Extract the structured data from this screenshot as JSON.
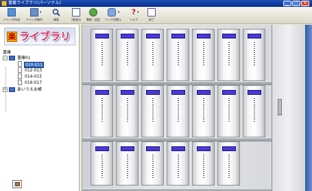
{
  "window": {
    "title": "書籍ライブラリ(パーソナル)",
    "minimize": "_",
    "maximize": "□",
    "close": "✕"
  },
  "toolbar": {
    "buttons": [
      {
        "label": "バインダ作成",
        "icon": "binder-create-icon"
      },
      {
        "label": "バインダ操作",
        "icon": "binder-operate-icon"
      },
      {
        "label": "検索",
        "icon": "search-icon"
      },
      {
        "label": "1枚表示",
        "icon": "single-page-icon"
      },
      {
        "label": "整理・設定",
        "icon": "organize-settings-icon"
      },
      {
        "label": "リンク切替え",
        "icon": "link-switch-icon"
      },
      {
        "label": "ヘルプ",
        "icon": "help-icon"
      },
      {
        "label": "終了",
        "icon": "exit-icon"
      }
    ]
  },
  "sidebar": {
    "logo_mark": "楽",
    "logo_text": "ライブラリ",
    "tree_header": "書庫",
    "tree": [
      {
        "label": "書庫01",
        "expander": "−",
        "level": 0
      },
      {
        "label": "010-011",
        "level": 1,
        "selected": true
      },
      {
        "label": "012-013",
        "level": 1
      },
      {
        "label": "014-015",
        "level": 1
      },
      {
        "label": "016-017",
        "level": 1
      },
      {
        "label": "あいうえお帳",
        "expander": "+",
        "level": 0
      }
    ]
  },
  "bookcase": {
    "rows": [
      {
        "books": 7
      },
      {
        "books": 7
      },
      {
        "books": 6
      }
    ],
    "colors": {
      "label": "#4a3ad8",
      "book": "#f6f6f7",
      "shelf": "#9ea2a9"
    }
  }
}
